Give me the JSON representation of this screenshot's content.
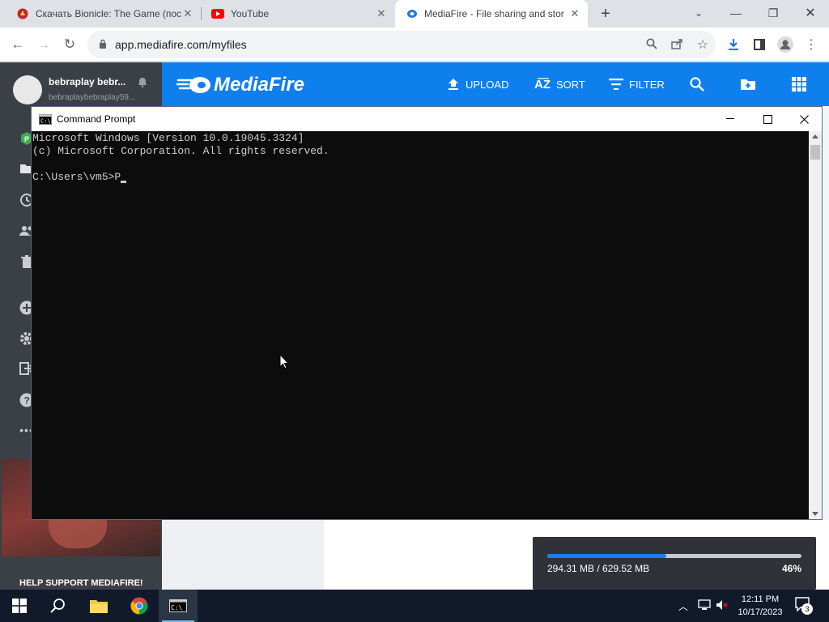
{
  "browser": {
    "tabs": [
      {
        "title": "Скачать Bionicle: The Game (пос",
        "favicon": "bionicle-icon",
        "active": false
      },
      {
        "title": "YouTube",
        "favicon": "youtube-icon",
        "active": false
      },
      {
        "title": "MediaFire - File sharing and stor",
        "favicon": "mediafire-icon",
        "active": true
      }
    ],
    "new_tab": "+",
    "url": "app.mediafire.com/myfiles"
  },
  "mediafire": {
    "user_name": "bebraplay bebr...",
    "user_email": "bebraplaybebraplay59...",
    "logo": "MediaFire",
    "header_actions": [
      {
        "label": "UPLOAD",
        "icon": "upload-icon"
      },
      {
        "label": "SORT",
        "icon": "sort-az-icon"
      },
      {
        "label": "FILTER",
        "icon": "filter-icon"
      }
    ],
    "help_banner": "HELP SUPPORT MEDIAFIRE!",
    "upload": {
      "status": "294.31 MB / 629.52 MB",
      "percent_label": "46%",
      "progress": 0.4675
    },
    "accent": "#0f7fee"
  },
  "cmd": {
    "title": "Command Prompt",
    "lines": [
      "Microsoft Windows [Version 10.0.19045.3324]",
      "(c) Microsoft Corporation. All rights reserved.",
      "",
      "C:\\Users\\vm5>P"
    ]
  },
  "taskbar": {
    "time": "12:11 PM",
    "date": "10/17/2023",
    "notifications": "3"
  }
}
